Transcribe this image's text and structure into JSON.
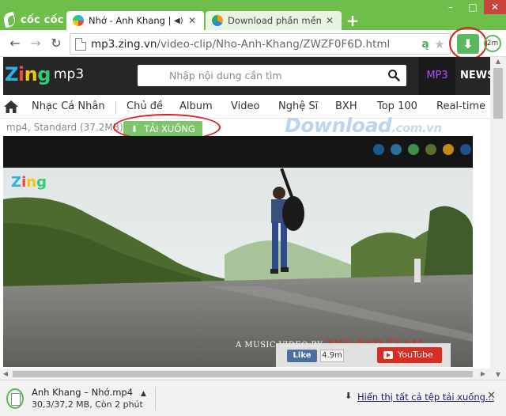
{
  "browser": {
    "brand": "cốc cốc",
    "tabs": [
      {
        "title": "Nhớ - Anh Khang | Vide",
        "active": true,
        "audio_icon": "speaker-icon"
      },
      {
        "title": "Download phần mềm miễ",
        "active": false
      }
    ],
    "window_controls": {
      "minimize": "–",
      "maximize": "□",
      "close": "✕"
    },
    "address": {
      "host": "mp3.zing.vn",
      "path": "/video-clip/Nho-Anh-Khang/ZWZF0F6D.html"
    },
    "download_button_icon": "download-arrow-icon",
    "timer_label": "2m",
    "accent_color": "#6dbe4a"
  },
  "zing": {
    "logo": {
      "z": "Z",
      "i": "i",
      "n": "n",
      "g": "g"
    },
    "product": "mp3",
    "search_placeholder": "Nhập nội dung cần tìm",
    "tabs": {
      "mp3": "MP3",
      "news": "NEWS"
    },
    "categories": [
      "Nhạc Cá Nhân",
      "Chủ đề",
      "Album",
      "Video",
      "Nghệ Sĩ",
      "BXH",
      "Top 100",
      "Real-time"
    ]
  },
  "download_strip": {
    "meta": "mp4, Standard (37.2MB)",
    "button": "TẢI XUỐNG",
    "watermark": "Download",
    "watermark_suffix": ".com.vn"
  },
  "video": {
    "logo": {
      "z": "Z",
      "i": "i",
      "n": "n",
      "g": "g"
    },
    "caption_left": "A MUSIC VIDEO BY",
    "caption_brand": "THE RED TEAM",
    "like_label": "Like",
    "like_count": "4.9m",
    "youtube_label": "YouTube",
    "color_dots": [
      "#1a5a8a",
      "#2a6e9a",
      "#3f8f4a",
      "#5a6f2f",
      "#c58a1a",
      "#22508a",
      "#b0291e"
    ]
  },
  "downloads_shelf": {
    "file_name": "Anh Khang – Nhớ.mp4",
    "file_status": "30,3/37,2 MB, Còn 2 phút",
    "menu_icon": "chevron-up-icon",
    "show_all": "Hiển thị tất cả tệp tải xuống...",
    "close": "✕"
  }
}
